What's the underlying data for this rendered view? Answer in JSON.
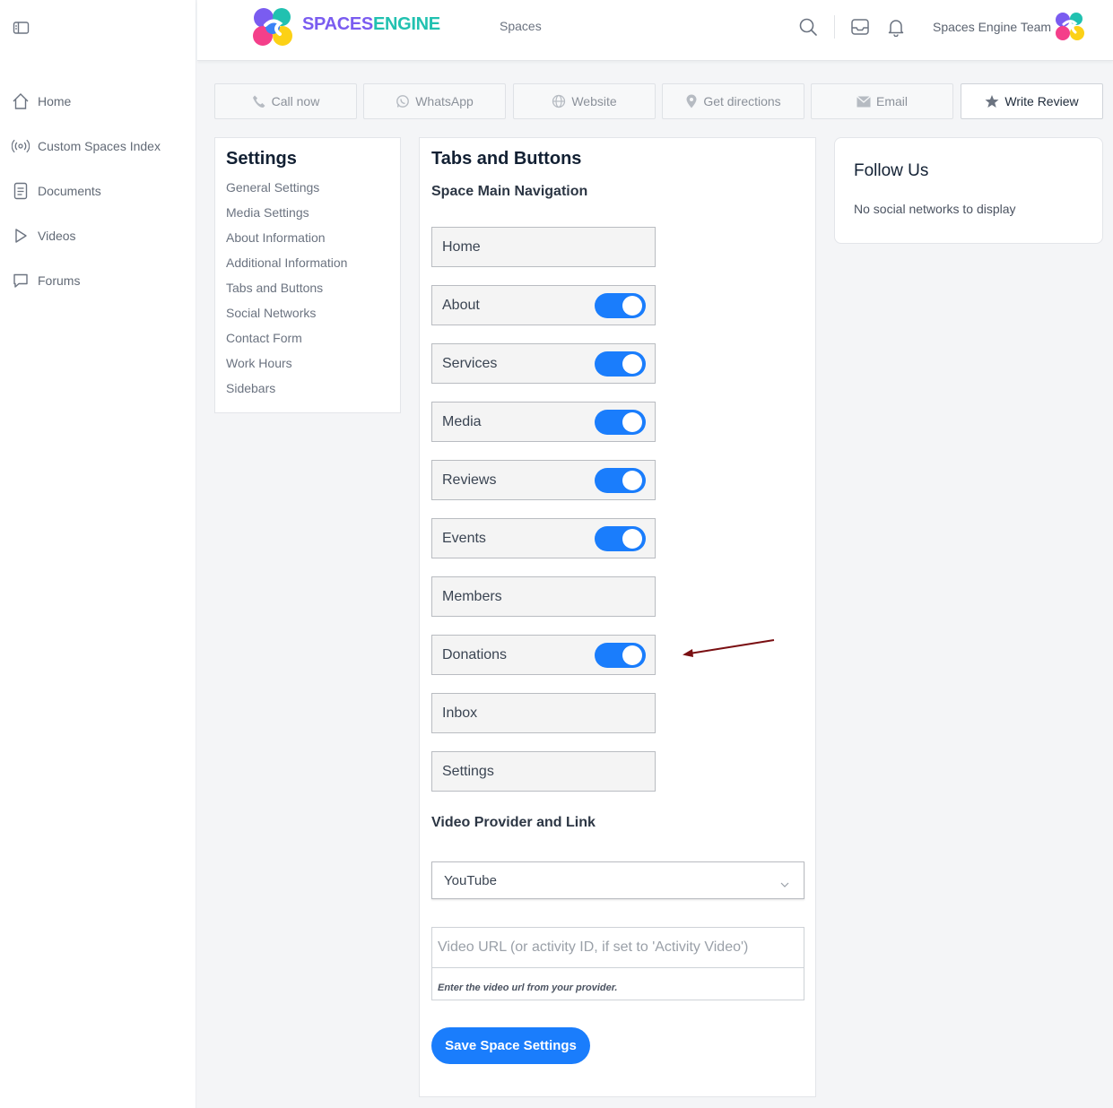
{
  "brand": {
    "part1": "SPACES",
    "part2": "ENGINE"
  },
  "topbar": {
    "spaces_link": "Spaces",
    "team_name": "Spaces Engine Team"
  },
  "sidebar": {
    "items": [
      {
        "label": "Home",
        "icon": "home-icon"
      },
      {
        "label": "Custom Spaces Index",
        "icon": "broadcast-icon"
      },
      {
        "label": "Documents",
        "icon": "document-icon"
      },
      {
        "label": "Videos",
        "icon": "play-icon"
      },
      {
        "label": "Forums",
        "icon": "chat-bubble-icon"
      }
    ]
  },
  "actions": {
    "call": "Call now",
    "whatsapp": "WhatsApp",
    "website": "Website",
    "directions": "Get directions",
    "email": "Email",
    "review": "Write Review"
  },
  "settings_nav": {
    "title": "Settings",
    "links": [
      "General Settings",
      "Media Settings",
      "About Information",
      "Additional Information",
      "Tabs and Buttons",
      "Social Networks",
      "Contact Form",
      "Work Hours",
      "Sidebars"
    ]
  },
  "main": {
    "title": "Tabs and Buttons",
    "nav_heading": "Space Main Navigation",
    "nav_items": [
      {
        "label": "Home",
        "toggle": false
      },
      {
        "label": "About",
        "toggle": true
      },
      {
        "label": "Services",
        "toggle": true
      },
      {
        "label": "Media",
        "toggle": true
      },
      {
        "label": "Reviews",
        "toggle": true
      },
      {
        "label": "Events",
        "toggle": true
      },
      {
        "label": "Members",
        "toggle": false
      },
      {
        "label": "Donations",
        "toggle": true
      },
      {
        "label": "Inbox",
        "toggle": false
      },
      {
        "label": "Settings",
        "toggle": false
      }
    ],
    "video_heading": "Video Provider and Link",
    "video_provider": "YouTube",
    "video_url_placeholder": "Video URL (or activity ID, if set to 'Activity Video')",
    "video_help": "Enter the video url from your provider.",
    "save_label": "Save Space Settings"
  },
  "follow": {
    "title": "Follow Us",
    "empty": "No social networks to display"
  },
  "colors": {
    "accent": "#1a7dfc",
    "brand_purple": "#7a5cf0",
    "brand_teal": "#21c1b0",
    "annotation_arrow": "#7a0f12"
  }
}
